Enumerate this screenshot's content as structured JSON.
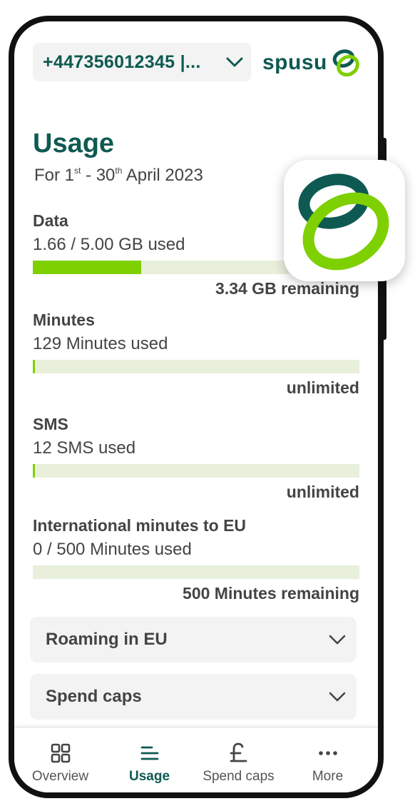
{
  "header": {
    "number_label": "+447356012345 |...",
    "brand_name": "spusu"
  },
  "usage": {
    "title": "Usage",
    "period": {
      "prefix": "For 1",
      "start_sup": "st",
      "middle": " - 30",
      "end_sup": "th",
      "suffix": " April 2023"
    }
  },
  "items": [
    {
      "label": "Data",
      "used": "1.66 / 5.00 GB used",
      "remaining": "3.34 GB remaining",
      "fill_fraction": 0.332
    },
    {
      "label": "Minutes",
      "used": "129 Minutes used",
      "remaining": "unlimited",
      "fill_fraction": 0.006
    },
    {
      "label": "SMS",
      "used": "12 SMS used",
      "remaining": "unlimited",
      "fill_fraction": 0.006
    },
    {
      "label": "International minutes to EU",
      "used": "0 / 500 Minutes used",
      "remaining": "500 Minutes remaining",
      "fill_fraction": 0
    }
  ],
  "accordions": [
    {
      "label": "Roaming in EU"
    },
    {
      "label": "Spend caps"
    }
  ],
  "nav": [
    {
      "label": "Overview",
      "icon": "grid-icon",
      "active": false
    },
    {
      "label": "Usage",
      "icon": "lines-icon",
      "active": true
    },
    {
      "label": "Spend caps",
      "icon": "pound-icon",
      "active": false
    },
    {
      "label": "More",
      "icon": "more-dots-icon",
      "active": false
    }
  ],
  "colors": {
    "brand_dark": "#0e5a52",
    "brand_green": "#7ed000",
    "bar_track": "#e8f0dc"
  }
}
